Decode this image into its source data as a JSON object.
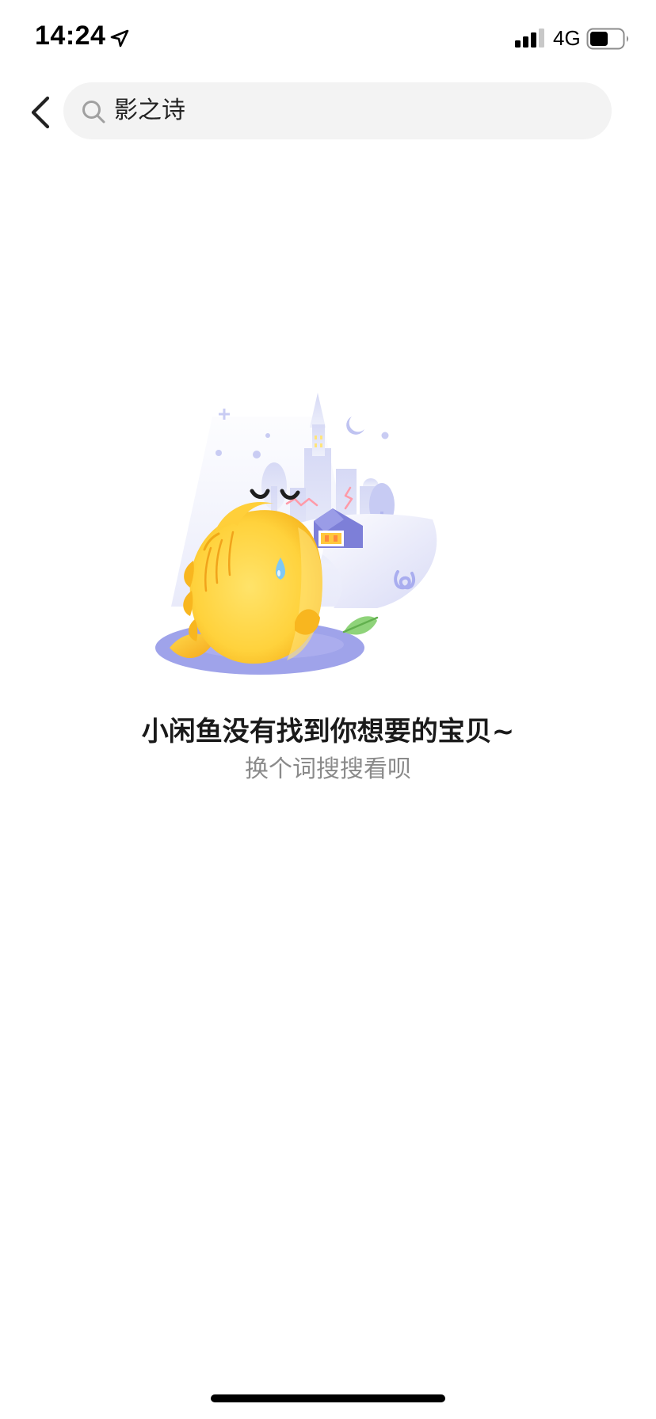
{
  "status_bar": {
    "time": "14:24",
    "network": "4G",
    "icons": [
      "location-arrow-icon",
      "signal-icon",
      "battery-icon"
    ]
  },
  "header": {
    "back_icon": "chevron-left-icon",
    "search": {
      "icon": "search-icon",
      "value": "影之诗"
    }
  },
  "empty_state": {
    "illustration": "sad-fish-illustration",
    "title": "小闲鱼没有找到你想要的宝贝~",
    "subtitle": "换个词搜搜看呗"
  },
  "colors": {
    "background": "#ffffff",
    "search_bg": "#f3f3f3",
    "title": "#1a1a1a",
    "subtitle": "#8a8a8a",
    "fish_yellow": "#ffd23c",
    "accent_purple": "#9fa3ea"
  }
}
